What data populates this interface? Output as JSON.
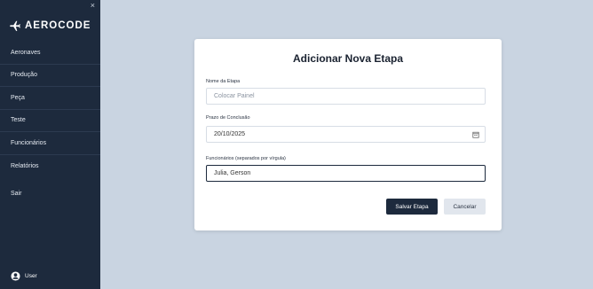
{
  "sidebar": {
    "close": "×",
    "brand": "AEROCODE",
    "items": [
      {
        "label": "Aeronaves"
      },
      {
        "label": "Produção"
      },
      {
        "label": "Peça"
      },
      {
        "label": "Teste"
      },
      {
        "label": "Funcionários"
      },
      {
        "label": "Relatórios"
      }
    ],
    "logout": "Sair",
    "user": "User"
  },
  "modal": {
    "title": "Adicionar Nova Etapa",
    "fields": {
      "name": {
        "label": "Nome da Etapa",
        "placeholder": "Colocar Painel"
      },
      "deadline": {
        "label": "Prazo de Conclusão",
        "value": "20/10/2025"
      },
      "employees": {
        "label": "Funcionários (separados por vírgula)",
        "value": "Julia, Gerson"
      }
    },
    "save_label": "Salvar Etapa",
    "cancel_label": "Cancelar"
  },
  "colors": {
    "sidebar_bg": "#1d2a3d",
    "page_bg": "#c9d4e1",
    "primary": "#1d2a3d",
    "secondary": "#e1e6ed"
  },
  "icons": {
    "brand": "airplane-icon",
    "close": "close-icon",
    "user": "user-icon",
    "calendar": "calendar-icon"
  }
}
